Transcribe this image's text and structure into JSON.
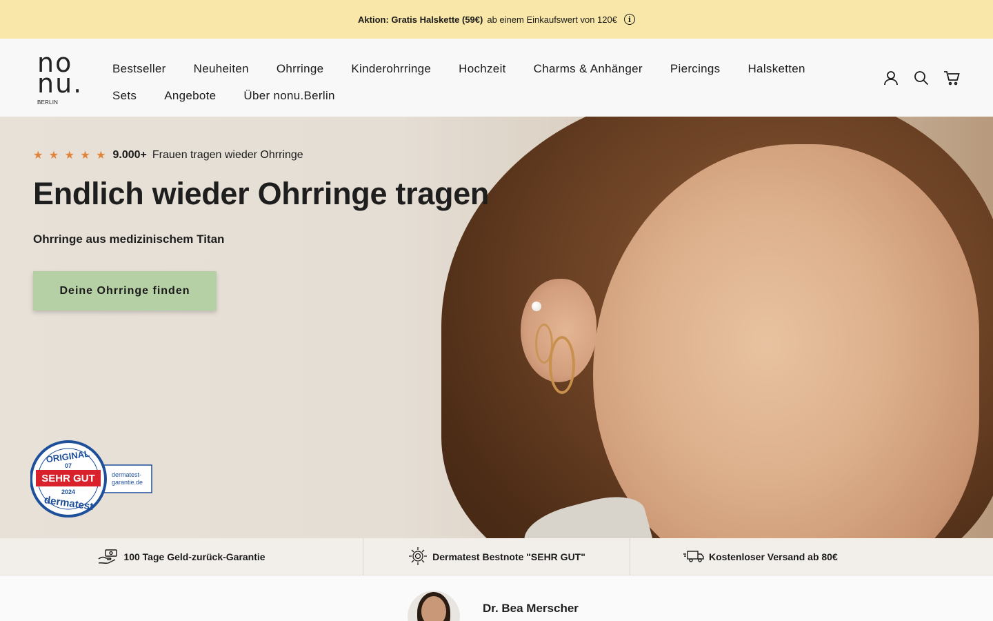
{
  "announcement": {
    "bold": "Aktion: Gratis Halskette (59€)",
    "text": "ab einem Einkaufswert von 120€",
    "icon": "info-icon"
  },
  "logo": {
    "line1": "no",
    "line2": "nu.",
    "line3": "BERLIN"
  },
  "nav": {
    "row1": [
      "Bestseller",
      "Neuheiten",
      "Ohrringe",
      "Kinderohrringe",
      "Hochzeit",
      "Charms & Anhänger",
      "Piercings",
      "Halsketten"
    ],
    "row2": [
      "Sets",
      "Angebote",
      "Über nonu.Berlin"
    ]
  },
  "header_icons": [
    "account-icon",
    "search-icon",
    "cart-icon"
  ],
  "hero": {
    "stars": "★ ★ ★ ★ ★",
    "rating_bold": "9.000+",
    "rating_text": "Frauen tragen wieder Ohrringe",
    "title": "Endlich wieder Ohrringe tragen",
    "subtitle": "Ohrringe aus medizinischem Titan",
    "cta": "Deine Ohrringe finden",
    "seal": {
      "top": "ORIGINAL",
      "number": "07",
      "grade": "SEHR GUT",
      "year": "2024",
      "brand": "dermatest",
      "side_line1": "dermatest-",
      "side_line2": "garantie.de"
    }
  },
  "trust": [
    {
      "icon": "money-hand-icon",
      "label": "100 Tage Geld-zurück-Garantie"
    },
    {
      "icon": "award-badge-icon",
      "label": "Dermatest Bestnote \"SEHR GUT\""
    },
    {
      "icon": "delivery-truck-icon",
      "label": "Kostenloser Versand ab 80€"
    }
  ],
  "expert": {
    "name": "Dr. Bea Merscher"
  },
  "colors": {
    "announcement_bg": "#f8e7a8",
    "cta_bg": "#b5d0a4",
    "star": "#e0833b",
    "seal_red": "#d8212b",
    "seal_blue": "#1d4f9a"
  }
}
